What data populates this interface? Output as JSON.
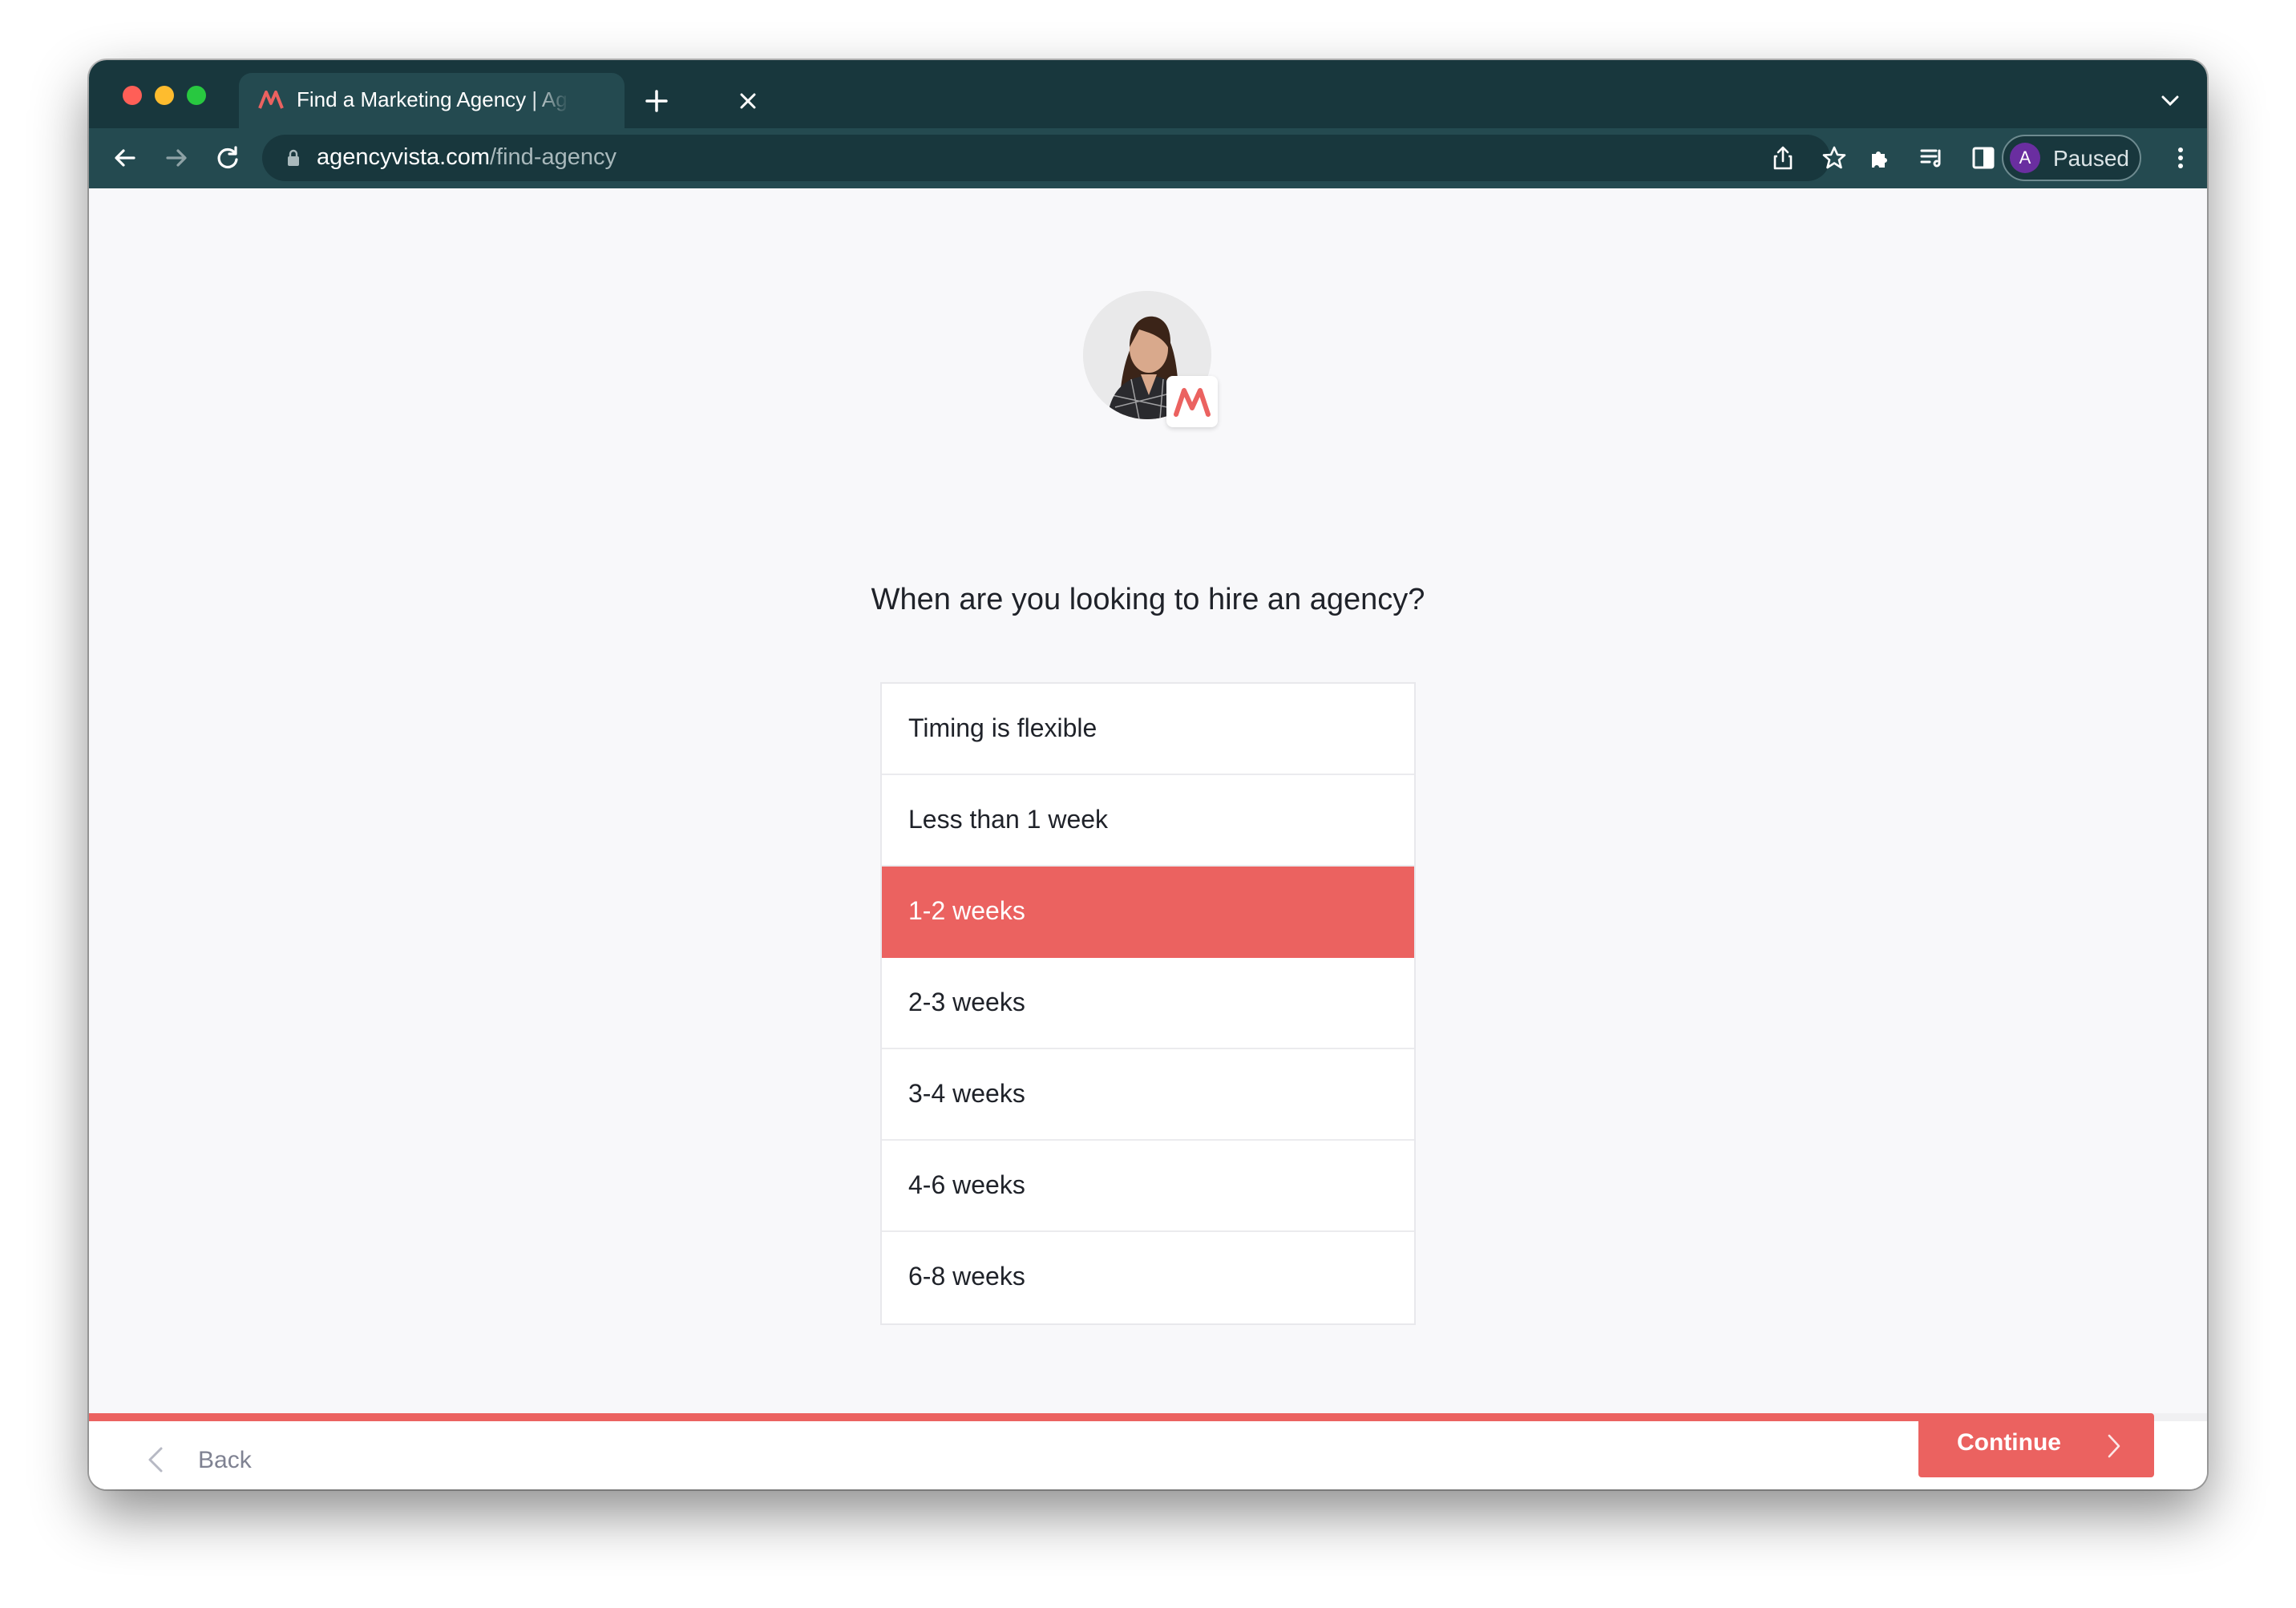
{
  "browser": {
    "tab": {
      "title": "Find a Marketing Agency | Agency Vista"
    },
    "address_bar": {
      "host": "agencyvista.com",
      "path": "/find-agency"
    },
    "profile": {
      "initial": "A",
      "status": "Paused",
      "avatar_color": "#6a2ea0"
    },
    "icons": [
      "back-arrow-icon",
      "forward-arrow-icon",
      "reload-icon",
      "lock-icon",
      "share-icon",
      "star-icon",
      "extensions-icon",
      "reading-list-icon",
      "side-panel-icon",
      "menu-icon"
    ]
  },
  "page": {
    "question": "When are you looking to hire an agency?",
    "options": [
      {
        "label": "Timing is flexible",
        "selected": false
      },
      {
        "label": "Less than 1 week",
        "selected": false
      },
      {
        "label": "1-2 weeks",
        "selected": true
      },
      {
        "label": "2-3 weeks",
        "selected": false
      },
      {
        "label": "3-4 weeks",
        "selected": false
      },
      {
        "label": "4-6 weeks",
        "selected": false
      },
      {
        "label": "6-8 weeks",
        "selected": false
      }
    ],
    "progress_fraction": 0.875,
    "accent_color": "#eb6260"
  },
  "footer": {
    "back_label": "Back",
    "continue_label": "Continue"
  }
}
